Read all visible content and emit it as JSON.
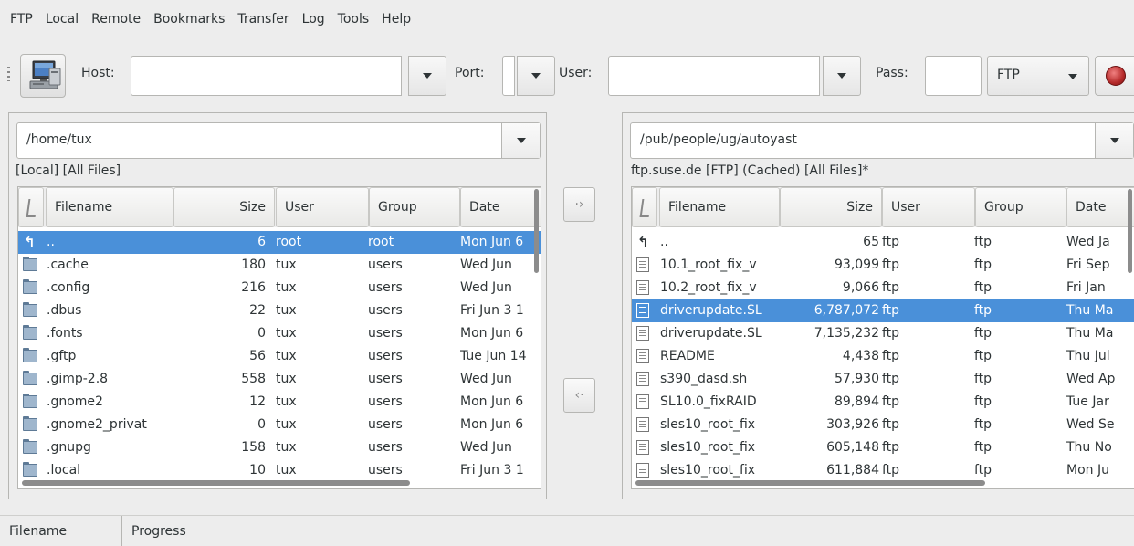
{
  "menubar": [
    "FTP",
    "Local",
    "Remote",
    "Bookmarks",
    "Transfer",
    "Log",
    "Tools",
    "Help"
  ],
  "toolbar": {
    "host_label": "Host:",
    "host_value": "",
    "port_label": "Port:",
    "port_value": "",
    "user_label": "User:",
    "user_value": "",
    "pass_label": "Pass:",
    "pass_value": "",
    "protocol": "FTP",
    "connect_icon": "computer-icon",
    "stop_icon": "stop-icon"
  },
  "local": {
    "path": "/home/tux",
    "status": "[Local] [All Files]",
    "columns": [
      "Filename",
      "Size",
      "User",
      "Group",
      "Date"
    ],
    "rows": [
      {
        "type": "up",
        "name": "..",
        "size": "6",
        "user": "root",
        "group": "root",
        "date": "Mon Jun 6",
        "selected": true
      },
      {
        "type": "folder",
        "name": ".cache",
        "size": "180",
        "user": "tux",
        "group": "users",
        "date": "Wed Jun"
      },
      {
        "type": "folder",
        "name": ".config",
        "size": "216",
        "user": "tux",
        "group": "users",
        "date": "Wed Jun"
      },
      {
        "type": "folder",
        "name": ".dbus",
        "size": "22",
        "user": "tux",
        "group": "users",
        "date": "Fri Jun 3 1"
      },
      {
        "type": "folder",
        "name": ".fonts",
        "size": "0",
        "user": "tux",
        "group": "users",
        "date": "Mon Jun 6"
      },
      {
        "type": "folder",
        "name": ".gftp",
        "size": "56",
        "user": "tux",
        "group": "users",
        "date": "Tue Jun 14"
      },
      {
        "type": "folder",
        "name": ".gimp-2.8",
        "size": "558",
        "user": "tux",
        "group": "users",
        "date": "Wed Jun"
      },
      {
        "type": "folder",
        "name": ".gnome2",
        "size": "12",
        "user": "tux",
        "group": "users",
        "date": "Mon Jun 6"
      },
      {
        "type": "folder",
        "name": ".gnome2_privat",
        "size": "0",
        "user": "tux",
        "group": "users",
        "date": "Mon Jun 6"
      },
      {
        "type": "folder",
        "name": ".gnupg",
        "size": "158",
        "user": "tux",
        "group": "users",
        "date": "Wed Jun"
      },
      {
        "type": "folder",
        "name": ".local",
        "size": "10",
        "user": "tux",
        "group": "users",
        "date": "Fri Jun 3 1"
      }
    ]
  },
  "remote": {
    "path": "/pub/people/ug/autoyast",
    "status": "ftp.suse.de [FTP] (Cached) [All Files]*",
    "columns": [
      "Filename",
      "Size",
      "User",
      "Group",
      "Date"
    ],
    "rows": [
      {
        "type": "up",
        "name": "..",
        "size": "65",
        "user": "ftp",
        "group": "ftp",
        "date": "Wed Ja"
      },
      {
        "type": "doc",
        "name": "10.1_root_fix_v",
        "size": "93,099",
        "user": "ftp",
        "group": "ftp",
        "date": "Fri Sep"
      },
      {
        "type": "doc",
        "name": "10.2_root_fix_v",
        "size": "9,066",
        "user": "ftp",
        "group": "ftp",
        "date": "Fri Jan"
      },
      {
        "type": "doc",
        "name": "driverupdate.SL",
        "size": "6,787,072",
        "user": "ftp",
        "group": "ftp",
        "date": "Thu Ma",
        "selected": true
      },
      {
        "type": "doc",
        "name": "driverupdate.SL",
        "size": "7,135,232",
        "user": "ftp",
        "group": "ftp",
        "date": "Thu Ma"
      },
      {
        "type": "doc",
        "name": "README",
        "size": "4,438",
        "user": "ftp",
        "group": "ftp",
        "date": "Thu Jul"
      },
      {
        "type": "doc",
        "name": "s390_dasd.sh",
        "size": "57,930",
        "user": "ftp",
        "group": "ftp",
        "date": "Wed Ap"
      },
      {
        "type": "doc",
        "name": "SL10.0_fixRAID",
        "size": "89,894",
        "user": "ftp",
        "group": "ftp",
        "date": "Tue Jar"
      },
      {
        "type": "doc",
        "name": "sles10_root_fix",
        "size": "303,926",
        "user": "ftp",
        "group": "ftp",
        "date": "Wed Se"
      },
      {
        "type": "doc",
        "name": "sles10_root_fix",
        "size": "605,148",
        "user": "ftp",
        "group": "ftp",
        "date": "Thu No"
      },
      {
        "type": "doc",
        "name": "sles10_root_fix",
        "size": "611,884",
        "user": "ftp",
        "group": "ftp",
        "date": "Mon Ju"
      }
    ]
  },
  "transfer": {
    "to_remote_icon": "arrow-right-icon",
    "to_local_icon": "arrow-left-icon"
  },
  "bottom_tabs": [
    "Filename",
    "Progress"
  ]
}
